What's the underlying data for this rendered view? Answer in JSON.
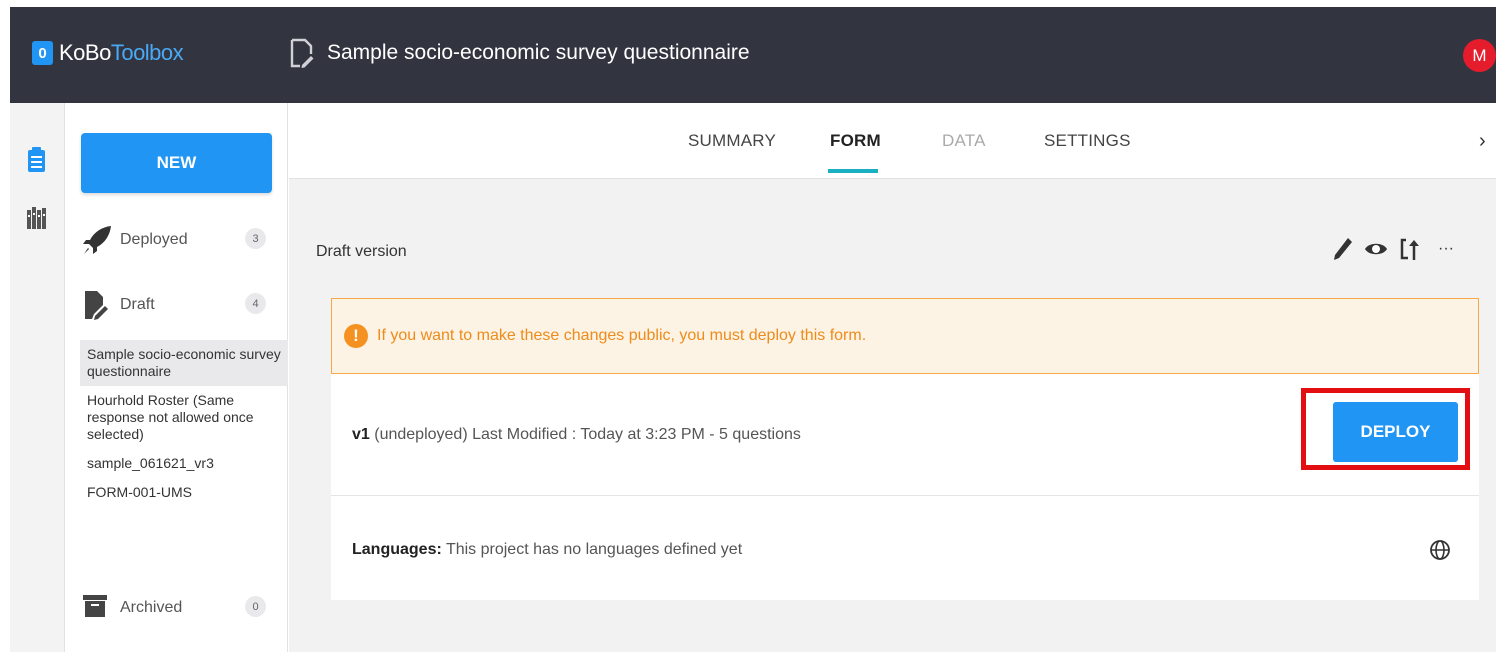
{
  "header": {
    "logo_badge": "0",
    "logo_brand": "KoBo",
    "logo_brand_light": "Toolbox",
    "form_title": "Sample socio-economic survey questionnaire",
    "avatar_initial": "M"
  },
  "sidebar": {
    "new_button": "NEW",
    "deployed": {
      "label": "Deployed",
      "count": "3"
    },
    "draft": {
      "label": "Draft",
      "count": "4"
    },
    "drafts": [
      "Sample socio-economic survey questionnaire",
      "Hourhold Roster (Same response not allowed once selected)",
      "sample_061621_vr3",
      "FORM-001-UMS"
    ],
    "archived": {
      "label": "Archived",
      "count": "0"
    }
  },
  "tabs": {
    "summary": "SUMMARY",
    "form": "FORM",
    "data": "DATA",
    "settings": "SETTINGS",
    "active": "FORM"
  },
  "main": {
    "draft_version_label": "Draft version",
    "more_label": "···",
    "warning_text": "If you want to make these changes public, you must deploy this form.",
    "version_name": "v1",
    "version_status": "(undeployed)",
    "version_details": "Last Modified : Today at 3:23 PM - 5 questions",
    "deploy_button": "DEPLOY",
    "languages_label": "Languages:",
    "languages_text": "This project has no languages defined yet"
  },
  "colors": {
    "topbar": "#32353f",
    "accent_blue": "#2095f3",
    "tab_underline": "#1ab0c1",
    "warning_border": "#f7a84b",
    "warning_text": "#ee8b1a",
    "highlight_red": "#e20e12",
    "avatar": "#e41c2c"
  },
  "icons": [
    "form-file-icon",
    "clipboard-icon",
    "library-icon",
    "rocket-icon",
    "draft-file-icon",
    "archive-box-icon",
    "pencil-icon",
    "eye-icon",
    "replace-icon",
    "more-icon",
    "exclamation-icon",
    "globe-icon",
    "chevron-right-icon"
  ]
}
